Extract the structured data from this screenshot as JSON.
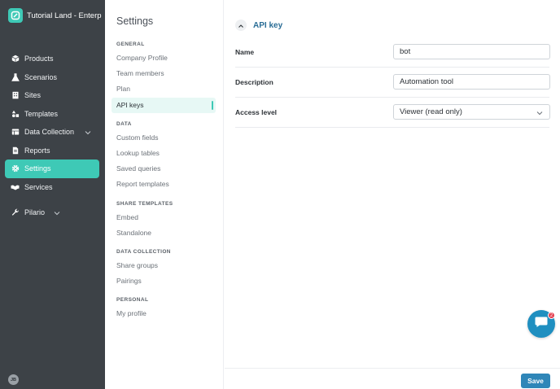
{
  "brand": {
    "name": "Tutorial Land - Enterpris",
    "accent": "#3ec9b6"
  },
  "sidebar": {
    "items": [
      {
        "label": "Products",
        "icon": "box-icon"
      },
      {
        "label": "Scenarios",
        "icon": "flask-icon"
      },
      {
        "label": "Sites",
        "icon": "building-icon"
      },
      {
        "label": "Templates",
        "icon": "shapes-icon"
      },
      {
        "label": "Data Collection",
        "icon": "table-icon",
        "expandable": true
      },
      {
        "label": "Reports",
        "icon": "report-icon"
      },
      {
        "label": "Settings",
        "icon": "gear-icon",
        "active": true
      },
      {
        "label": "Services",
        "icon": "handshake-icon"
      },
      {
        "label": "Pilario",
        "icon": "wrench-icon",
        "expandable": true
      }
    ],
    "avatar_initials": "JB"
  },
  "settings_nav": {
    "title": "Settings",
    "sections": [
      {
        "heading": "GENERAL",
        "items": [
          "Company Profile",
          "Team members",
          "Plan",
          "API keys"
        ]
      },
      {
        "heading": "DATA",
        "items": [
          "Custom fields",
          "Lookup tables",
          "Saved queries",
          "Report templates"
        ]
      },
      {
        "heading": "SHARE TEMPLATES",
        "items": [
          "Embed",
          "Standalone"
        ]
      },
      {
        "heading": "DATA COLLECTION",
        "items": [
          "Share groups",
          "Pairings"
        ]
      },
      {
        "heading": "PERSONAL",
        "items": [
          "My profile"
        ]
      }
    ],
    "active_item": "API keys"
  },
  "main": {
    "section_title": "API key",
    "fields": {
      "name": {
        "label": "Name",
        "value": "bot"
      },
      "description": {
        "label": "Description",
        "value": "Automation tool"
      },
      "access_level": {
        "label": "Access level",
        "value": "Viewer (read only)"
      }
    },
    "save_label": "Save"
  },
  "chat": {
    "badge_count": "2"
  },
  "colors": {
    "sidebar_bg": "#3d4247",
    "active": "#3ec9b6",
    "primary": "#2f86b8",
    "title": "#2a6d96"
  }
}
